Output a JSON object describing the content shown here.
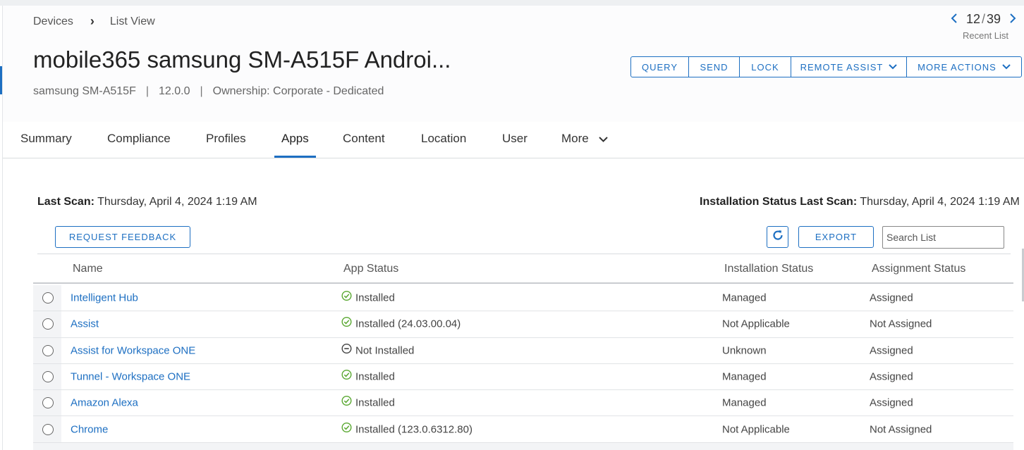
{
  "breadcrumb": {
    "root": "Devices",
    "current": "List View"
  },
  "pager": {
    "current": "12",
    "total": "39",
    "separator": "/",
    "label": "Recent List"
  },
  "device": {
    "title": "mobile365 samsung SM-A515F Androi...",
    "model": "samsung SM-A515F",
    "os_version": "12.0.0",
    "ownership": "Ownership: Corporate - Dedicated",
    "pipe": "|"
  },
  "actions": {
    "query": "QUERY",
    "send": "SEND",
    "lock": "LOCK",
    "remote_assist": "REMOTE ASSIST",
    "more_actions": "MORE ACTIONS"
  },
  "tabs": {
    "summary": "Summary",
    "compliance": "Compliance",
    "profiles": "Profiles",
    "apps": "Apps",
    "content": "Content",
    "location": "Location",
    "user": "User",
    "more": "More"
  },
  "scan": {
    "last_label": "Last Scan:",
    "last_value": "Thursday, April 4, 2024 1:19 AM",
    "install_label": "Installation Status Last Scan:",
    "install_value": "Thursday, April 4, 2024 1:19 AM"
  },
  "toolbar": {
    "request_feedback": "REQUEST FEEDBACK",
    "export": "EXPORT",
    "search_placeholder": "Search List"
  },
  "table": {
    "headers": {
      "name": "Name",
      "app_status": "App Status",
      "installation_status": "Installation Status",
      "assignment_status": "Assignment Status"
    },
    "rows": [
      {
        "name": "Intelligent Hub",
        "status": "Installed",
        "status_icon": "check-circle-icon",
        "install": "Managed",
        "assign": "Assigned"
      },
      {
        "name": "Assist",
        "status": "Installed (24.03.00.04)",
        "status_icon": "check-circle-icon",
        "install": "Not Applicable",
        "assign": "Not Assigned"
      },
      {
        "name": "Assist for Workspace ONE",
        "status": "Not Installed",
        "status_icon": "minus-circle-icon",
        "install": "Unknown",
        "assign": "Assigned"
      },
      {
        "name": "Tunnel - Workspace ONE",
        "status": "Installed",
        "status_icon": "check-circle-icon",
        "install": "Managed",
        "assign": "Assigned"
      },
      {
        "name": "Amazon Alexa",
        "status": "Installed",
        "status_icon": "check-circle-icon",
        "install": "Managed",
        "assign": "Assigned"
      },
      {
        "name": "Chrome",
        "status": "Installed (123.0.6312.80)",
        "status_icon": "check-circle-icon",
        "install": "Not Applicable",
        "assign": "Not Assigned"
      }
    ]
  },
  "colors": {
    "accent": "#1d6fc2",
    "installed": "#5aa832",
    "not_installed": "#444444"
  }
}
